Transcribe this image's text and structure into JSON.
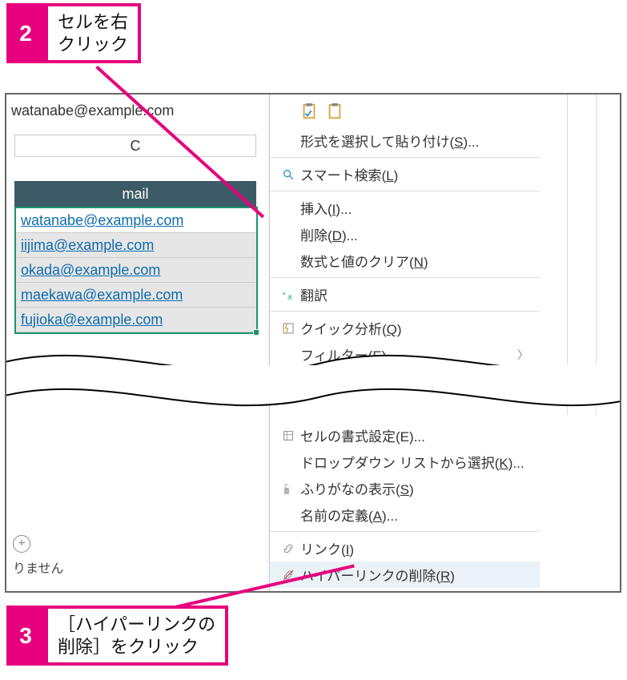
{
  "callouts": {
    "step2": {
      "num": "2",
      "text": "セルを右\nクリック"
    },
    "step3": {
      "num": "3",
      "text": "［ハイパーリンクの\n削除］をクリック"
    }
  },
  "formula_bar": "watanabe@example.com",
  "column_letter": "C",
  "table": {
    "header": "mail",
    "rows": [
      "watanabe@example.com",
      "iijima@example.com",
      "okada@example.com",
      "maekawa@example.com",
      "fujioka@example.com"
    ]
  },
  "context_menu_top": [
    {
      "label": "形式を選択して貼り付け(S)...",
      "u": "S",
      "icon": ""
    },
    {
      "sep": true
    },
    {
      "label": "スマート検索(L)",
      "u": "L",
      "icon": "search"
    },
    {
      "sep": true
    },
    {
      "label": "挿入(I)...",
      "u": "I",
      "icon": ""
    },
    {
      "label": "削除(D)...",
      "u": "D",
      "icon": ""
    },
    {
      "label": "数式と値のクリア(N)",
      "u": "N",
      "icon": ""
    },
    {
      "sep": true
    },
    {
      "label": "翻訳",
      "icon": "translate"
    },
    {
      "sep": true
    },
    {
      "label": "クイック分析(Q)",
      "u": "Q",
      "icon": "quick"
    },
    {
      "label": "フィルター(E)",
      "u": "E",
      "icon": "",
      "arrow": true
    }
  ],
  "context_menu_bottom": [
    {
      "label": "セルの書式設定(E)...",
      "u": "",
      "icon": "format"
    },
    {
      "label": "ドロップダウン リストから選択(K)...",
      "u": "K",
      "icon": ""
    },
    {
      "label": "ふりがなの表示(S)",
      "u": "S",
      "icon": "furigana"
    },
    {
      "label": "名前の定義(A)...",
      "u": "A",
      "icon": ""
    },
    {
      "sep": true
    },
    {
      "label": "リンク(I)",
      "u": "I",
      "icon": "link"
    },
    {
      "label": "ハイパーリンクの削除(R)",
      "u": "R",
      "icon": "unlink",
      "highlight": true
    }
  ],
  "bottom_bar_text": "りません"
}
